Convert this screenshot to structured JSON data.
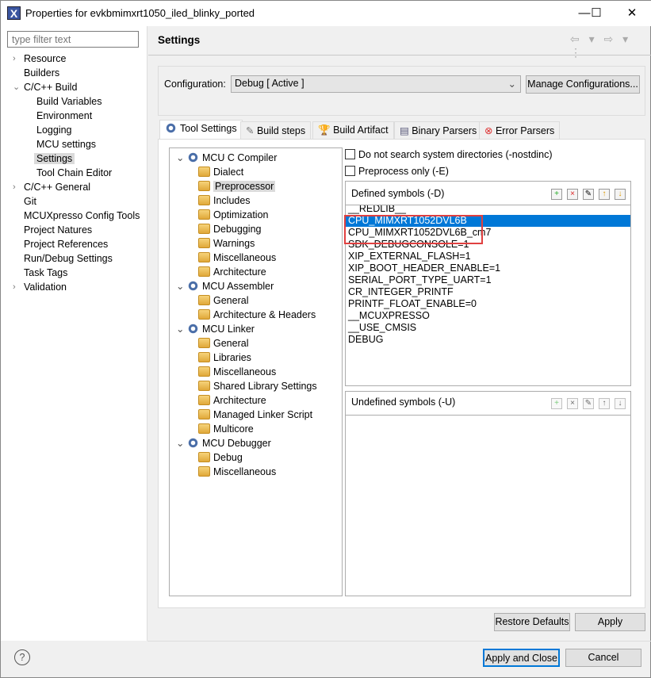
{
  "window": {
    "title": "Properties for evkbmimxrt1050_iled_blinky_ported",
    "minimize": "—",
    "maximize": "☐",
    "close": "✕"
  },
  "filter": {
    "placeholder": "type filter text"
  },
  "nav": [
    {
      "label": "Resource",
      "level": 0,
      "arrow": "›"
    },
    {
      "label": "Builders",
      "level": 0,
      "arrow": ""
    },
    {
      "label": "C/C++ Build",
      "level": 0,
      "arrow": "⌄"
    },
    {
      "label": "Build Variables",
      "level": 1,
      "arrow": ""
    },
    {
      "label": "Environment",
      "level": 1,
      "arrow": ""
    },
    {
      "label": "Logging",
      "level": 1,
      "arrow": ""
    },
    {
      "label": "MCU settings",
      "level": 1,
      "arrow": ""
    },
    {
      "label": "Settings",
      "level": 1,
      "arrow": "",
      "selected": true
    },
    {
      "label": "Tool Chain Editor",
      "level": 1,
      "arrow": ""
    },
    {
      "label": "C/C++ General",
      "level": 0,
      "arrow": "›"
    },
    {
      "label": "Git",
      "level": 0,
      "arrow": ""
    },
    {
      "label": "MCUXpresso Config Tools",
      "level": 0,
      "arrow": ""
    },
    {
      "label": "Project Natures",
      "level": 0,
      "arrow": ""
    },
    {
      "label": "Project References",
      "level": 0,
      "arrow": ""
    },
    {
      "label": "Run/Debug Settings",
      "level": 0,
      "arrow": ""
    },
    {
      "label": "Task Tags",
      "level": 0,
      "arrow": ""
    },
    {
      "label": "Validation",
      "level": 0,
      "arrow": "›"
    }
  ],
  "page": {
    "title": "Settings",
    "nav_arrows": "⇦ ▾ ⇨ ▾ ⋮"
  },
  "config": {
    "label": "Configuration:",
    "value": "Debug  [ Active ]",
    "manage": "Manage Configurations..."
  },
  "tabs": [
    "Tool Settings",
    "Build steps",
    "Build Artifact",
    "Binary Parsers",
    "Error Parsers"
  ],
  "tool_tree": [
    {
      "label": "MCU C Compiler",
      "cat": true
    },
    {
      "label": "Dialect"
    },
    {
      "label": "Preprocessor",
      "selected": true
    },
    {
      "label": "Includes"
    },
    {
      "label": "Optimization"
    },
    {
      "label": "Debugging"
    },
    {
      "label": "Warnings"
    },
    {
      "label": "Miscellaneous"
    },
    {
      "label": "Architecture"
    },
    {
      "label": "MCU Assembler",
      "cat": true
    },
    {
      "label": "General"
    },
    {
      "label": "Architecture & Headers"
    },
    {
      "label": "MCU Linker",
      "cat": true
    },
    {
      "label": "General"
    },
    {
      "label": "Libraries"
    },
    {
      "label": "Miscellaneous"
    },
    {
      "label": "Shared Library Settings"
    },
    {
      "label": "Architecture"
    },
    {
      "label": "Managed Linker Script"
    },
    {
      "label": "Multicore"
    },
    {
      "label": "MCU Debugger",
      "cat": true
    },
    {
      "label": "Debug"
    },
    {
      "label": "Miscellaneous"
    }
  ],
  "options": {
    "nostdinc": "Do not search system directories (-nostdinc)",
    "preprocess_only": "Preprocess only (-E)"
  },
  "defined": {
    "title": "Defined symbols (-D)",
    "items": [
      "__REDLIB__",
      "CPU_MIMXRT1052DVL6B",
      "CPU_MIMXRT1052DVL6B_cm7",
      "SDK_DEBUGCONSOLE=1",
      "XIP_EXTERNAL_FLASH=1",
      "XIP_BOOT_HEADER_ENABLE=1",
      "SERIAL_PORT_TYPE_UART=1",
      "CR_INTEGER_PRINTF",
      "PRINTF_FLOAT_ENABLE=0",
      "__MCUXPRESSO",
      "__USE_CMSIS",
      "DEBUG"
    ],
    "selected_index": 1,
    "highlight_color": "#e04040"
  },
  "undefined": {
    "title": "Undefined symbols (-U)"
  },
  "buttons": {
    "restore": "Restore Defaults",
    "apply": "Apply",
    "apply_close": "Apply and Close",
    "cancel": "Cancel",
    "help": "?"
  }
}
